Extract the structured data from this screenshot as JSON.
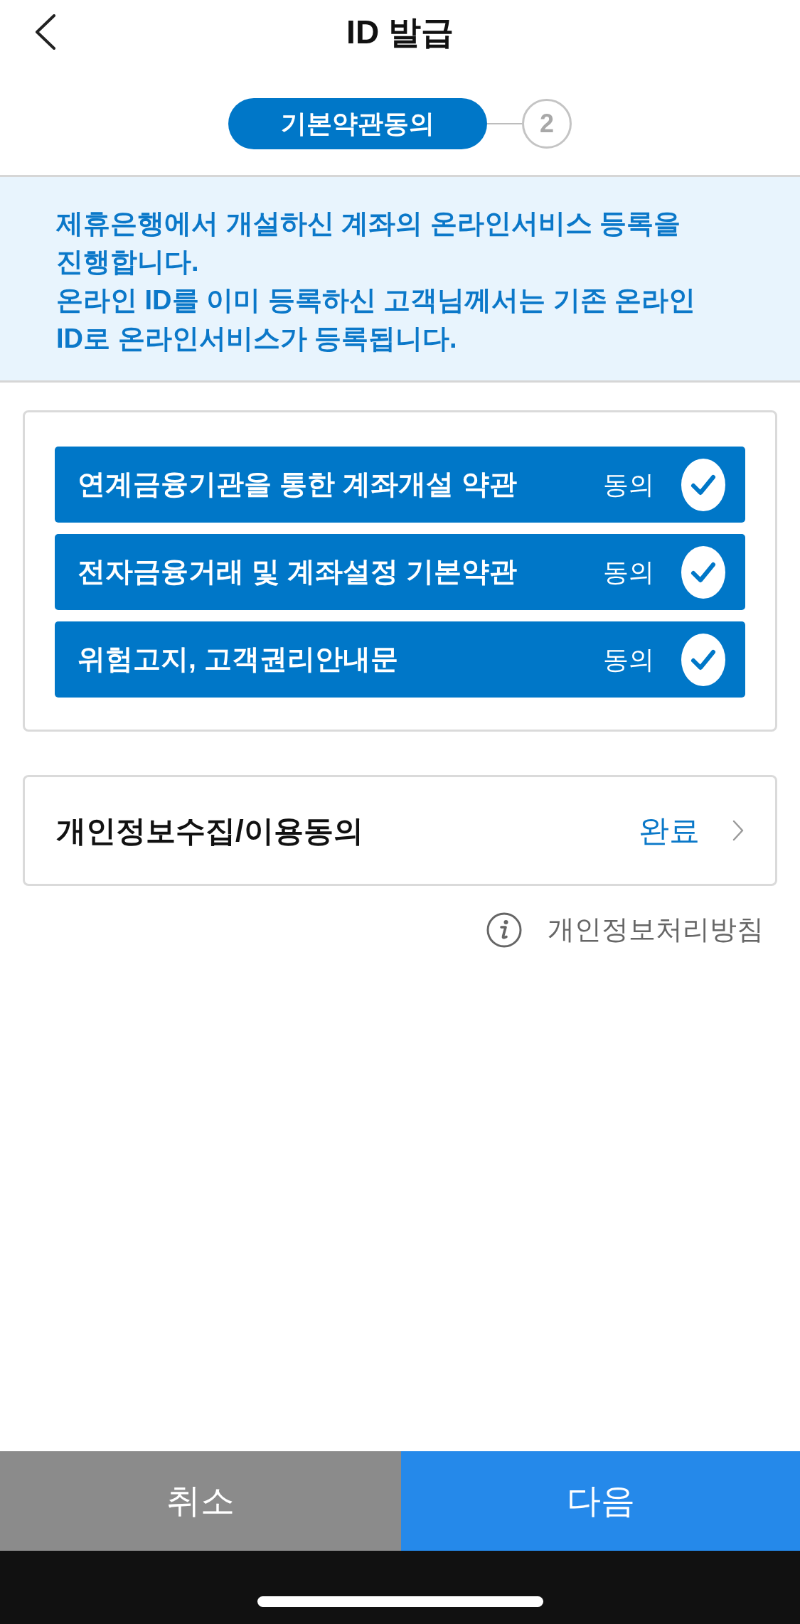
{
  "header": {
    "title": "ID 발급"
  },
  "stepper": {
    "steps": [
      {
        "label": "기본약관동의",
        "selected": true
      },
      {
        "label": "2",
        "selected": false
      }
    ]
  },
  "notice": {
    "paragraphs": [
      "제휴은행에서 개설하신 계좌의 온라인서비스 등록을 진행합니다.",
      "온라인 ID를 이미 등록하신 고객님께서는 기존 온라인 ID로 온라인서비스가 등록됩니다."
    ]
  },
  "agreements": [
    {
      "label": "연계금융기관을 통한 계좌개설 약관",
      "status": "동의",
      "checked": true
    },
    {
      "label": "전자금융거래 및 계좌설정 기본약관",
      "status": "동의",
      "checked": true
    },
    {
      "label": "위험고지, 고객권리안내문",
      "status": "동의",
      "checked": true
    }
  ],
  "privacy_consent": {
    "label": "개인정보수집/이용동의",
    "status": "완료"
  },
  "policy_link": {
    "label": "개인정보처리방침"
  },
  "buttons": [
    {
      "label": "취소",
      "kind": "secondary"
    },
    {
      "label": "다음",
      "kind": "primary"
    }
  ]
}
